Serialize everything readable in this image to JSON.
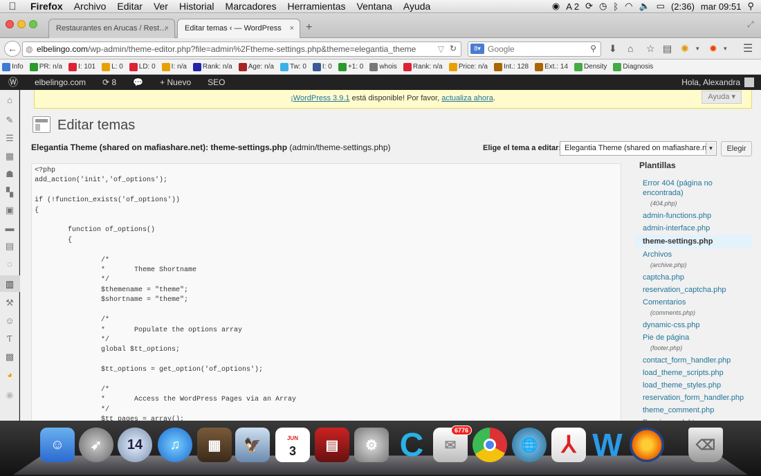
{
  "menubar": {
    "app": "Firefox",
    "items": [
      "Archivo",
      "Editar",
      "Ver",
      "Historial",
      "Marcadores",
      "Herramientas",
      "Ventana",
      "Ayuda"
    ],
    "status_items": [
      "A 2",
      "(2:36)"
    ],
    "clock": "mar 09:51"
  },
  "tabs": [
    {
      "title": "Restaurantes en Arucas / Rest…",
      "close": "×"
    },
    {
      "title": "Editar temas ‹ — WordPress",
      "close": "×"
    }
  ],
  "new_tab": "+",
  "navbar": {
    "url_host": "elbelingo.com",
    "url_path": "/wp-admin/theme-editor.php?file=admin%2Ftheme-settings.php&theme=elegantia_theme",
    "search_placeholder": "Google"
  },
  "seobar": [
    {
      "label": "Info",
      "color": "#3b7bd4"
    },
    {
      "label": "PR: n/a",
      "color": "#2a9a2a"
    },
    {
      "label": "I: 101",
      "color": "#d23"
    },
    {
      "label": "L: 0",
      "color": "#e8a000"
    },
    {
      "label": "LD: 0",
      "color": "#d23"
    },
    {
      "label": "I: n/a",
      "color": "#e8a000"
    },
    {
      "label": "Rank: n/a",
      "color": "#22a"
    },
    {
      "label": "Age: n/a",
      "color": "#a22"
    },
    {
      "label": "Tw: 0",
      "color": "#3ab0e8"
    },
    {
      "label": "I: 0",
      "color": "#3b5998"
    },
    {
      "label": "+1: 0",
      "color": "#2a9a2a"
    },
    {
      "label": "whois",
      "color": "#777"
    },
    {
      "label": "Rank: n/a",
      "color": "#d23"
    },
    {
      "label": "Price: n/a",
      "color": "#e8a000"
    },
    {
      "label": "Int.: 128",
      "color": "#a60"
    },
    {
      "label": "Ext.: 14",
      "color": "#a60"
    },
    {
      "label": "Density",
      "color": "#4a4"
    },
    {
      "label": "Diagnosis",
      "color": "#4a4"
    }
  ],
  "wpbar": {
    "site": "elbelingo.com",
    "updates": "8",
    "new": "Nuevo",
    "seo": "SEO",
    "greeting": "Hola, Alexandra"
  },
  "notice": {
    "pre": "¡WordPress 3.9.1",
    "mid": " está disponible! Por favor, ",
    "link": "actualiza ahora",
    "post": "."
  },
  "help": "Ayuda ▾",
  "page": {
    "title": "Editar temas",
    "file_heading": "Elegantia Theme (shared on mafiashare.net): theme-settings.php",
    "file_path": "(admin/theme-settings.php)",
    "choose_label": "Elige el tema a editar:",
    "selected_theme": "Elegantia Theme (shared on mafiashare.net)",
    "choose_button": "Elegir"
  },
  "code": "<?php\nadd_action('init','of_options');\n\nif (!function_exists('of_options'))\n{\n\n        function of_options()\n        {\n\n                /*\n                *       Theme Shortname\n                */\n                $themename = \"theme\";\n                $shortname = \"theme\";\n\n                /*\n                *       Populate the options array\n                */\n                global $tt_options;\n\n                $tt_options = get_option('of_options');\n\n                /*\n                *       Access the WordPress Pages via an Array\n                */\n                $tt_pages = array();",
  "templates": {
    "heading": "Plantillas",
    "items": [
      {
        "name": "Error 404 (página no encontrada)",
        "file": "(404.php)"
      },
      {
        "name": "admin-functions.php",
        "file": ""
      },
      {
        "name": "admin-interface.php",
        "file": ""
      },
      {
        "name": "theme-settings.php",
        "file": "",
        "current": true
      },
      {
        "name": "Archivos",
        "file": "(archive.php)"
      },
      {
        "name": "captcha.php",
        "file": ""
      },
      {
        "name": "reservation_captcha.php",
        "file": ""
      },
      {
        "name": "Comentarios",
        "file": "(comments.php)"
      },
      {
        "name": "dynamic-css.php",
        "file": ""
      },
      {
        "name": "Pie de página",
        "file": "(footer.php)"
      },
      {
        "name": "contact_form_handler.php",
        "file": ""
      },
      {
        "name": "load_theme_scripts.php",
        "file": ""
      },
      {
        "name": "load_theme_styles.php",
        "file": ""
      },
      {
        "name": "reservation_form_handler.php",
        "file": ""
      },
      {
        "name": "theme_comment.php",
        "file": ""
      },
      {
        "name": "Funciones del tema",
        "file": ""
      }
    ]
  },
  "dock": {
    "calendar_month": "JUN",
    "calendar_day": "3",
    "clock_day": "14",
    "mail_badge": "6776"
  }
}
